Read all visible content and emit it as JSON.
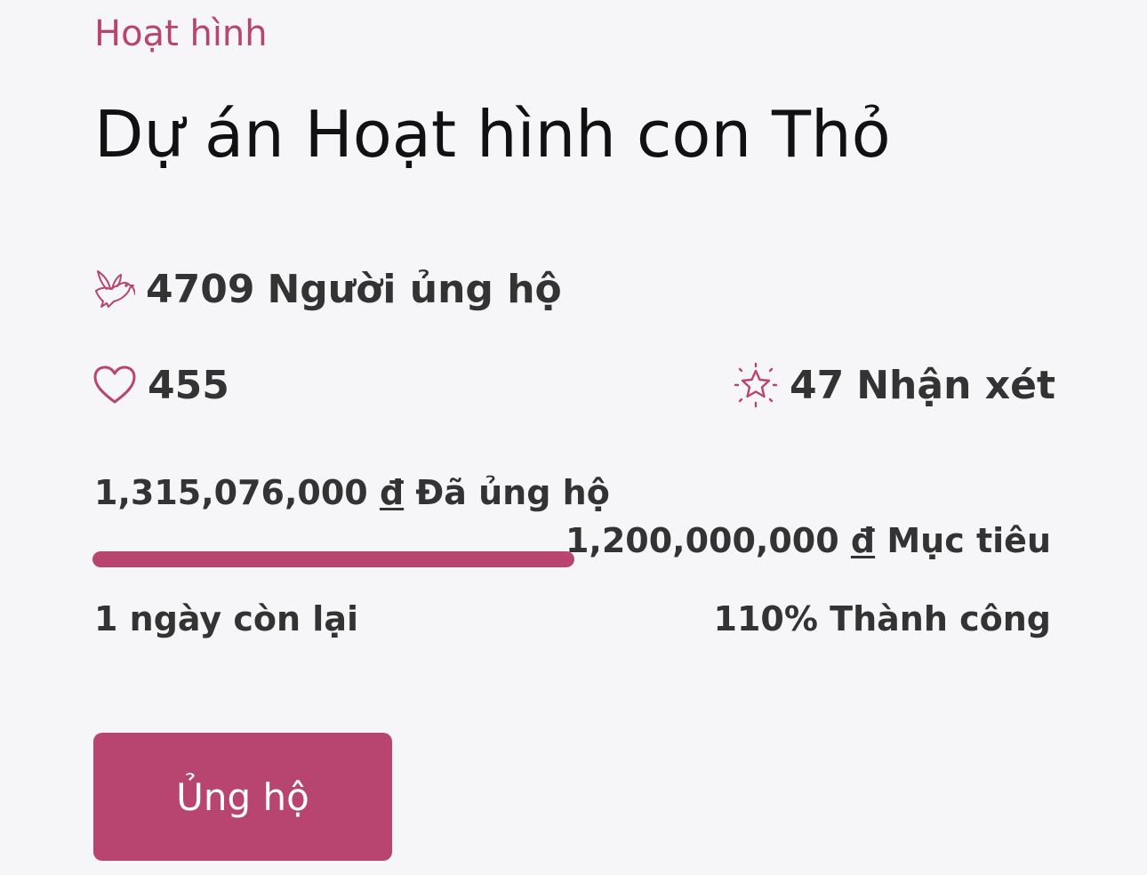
{
  "project": {
    "category": "Hoạt hình",
    "title": "Dự án Hoạt hình con Thỏ"
  },
  "stats": {
    "supporters_count": "4709",
    "supporters_label": "Người ủng hộ",
    "likes_count": "455",
    "reviews_count": "47",
    "reviews_label": "Nhận xét"
  },
  "funding": {
    "raised_amount": "1,315,076,000",
    "currency": "đ",
    "raised_label": "Đã ủng hộ",
    "goal_amount": "1,200,000,000",
    "goal_label": "Mục tiêu",
    "progress_percent": 100,
    "days_left": "1 ngày còn lại",
    "success_text": "110% Thành công"
  },
  "actions": {
    "support_label": "Ủng hộ"
  },
  "icons": {
    "supporters": "dove-icon",
    "likes": "heart-icon",
    "reviews": "sparkle-star-icon"
  },
  "colors": {
    "accent": "#b84470",
    "background": "#f6f6f8",
    "text": "#333333",
    "title": "#111111"
  }
}
